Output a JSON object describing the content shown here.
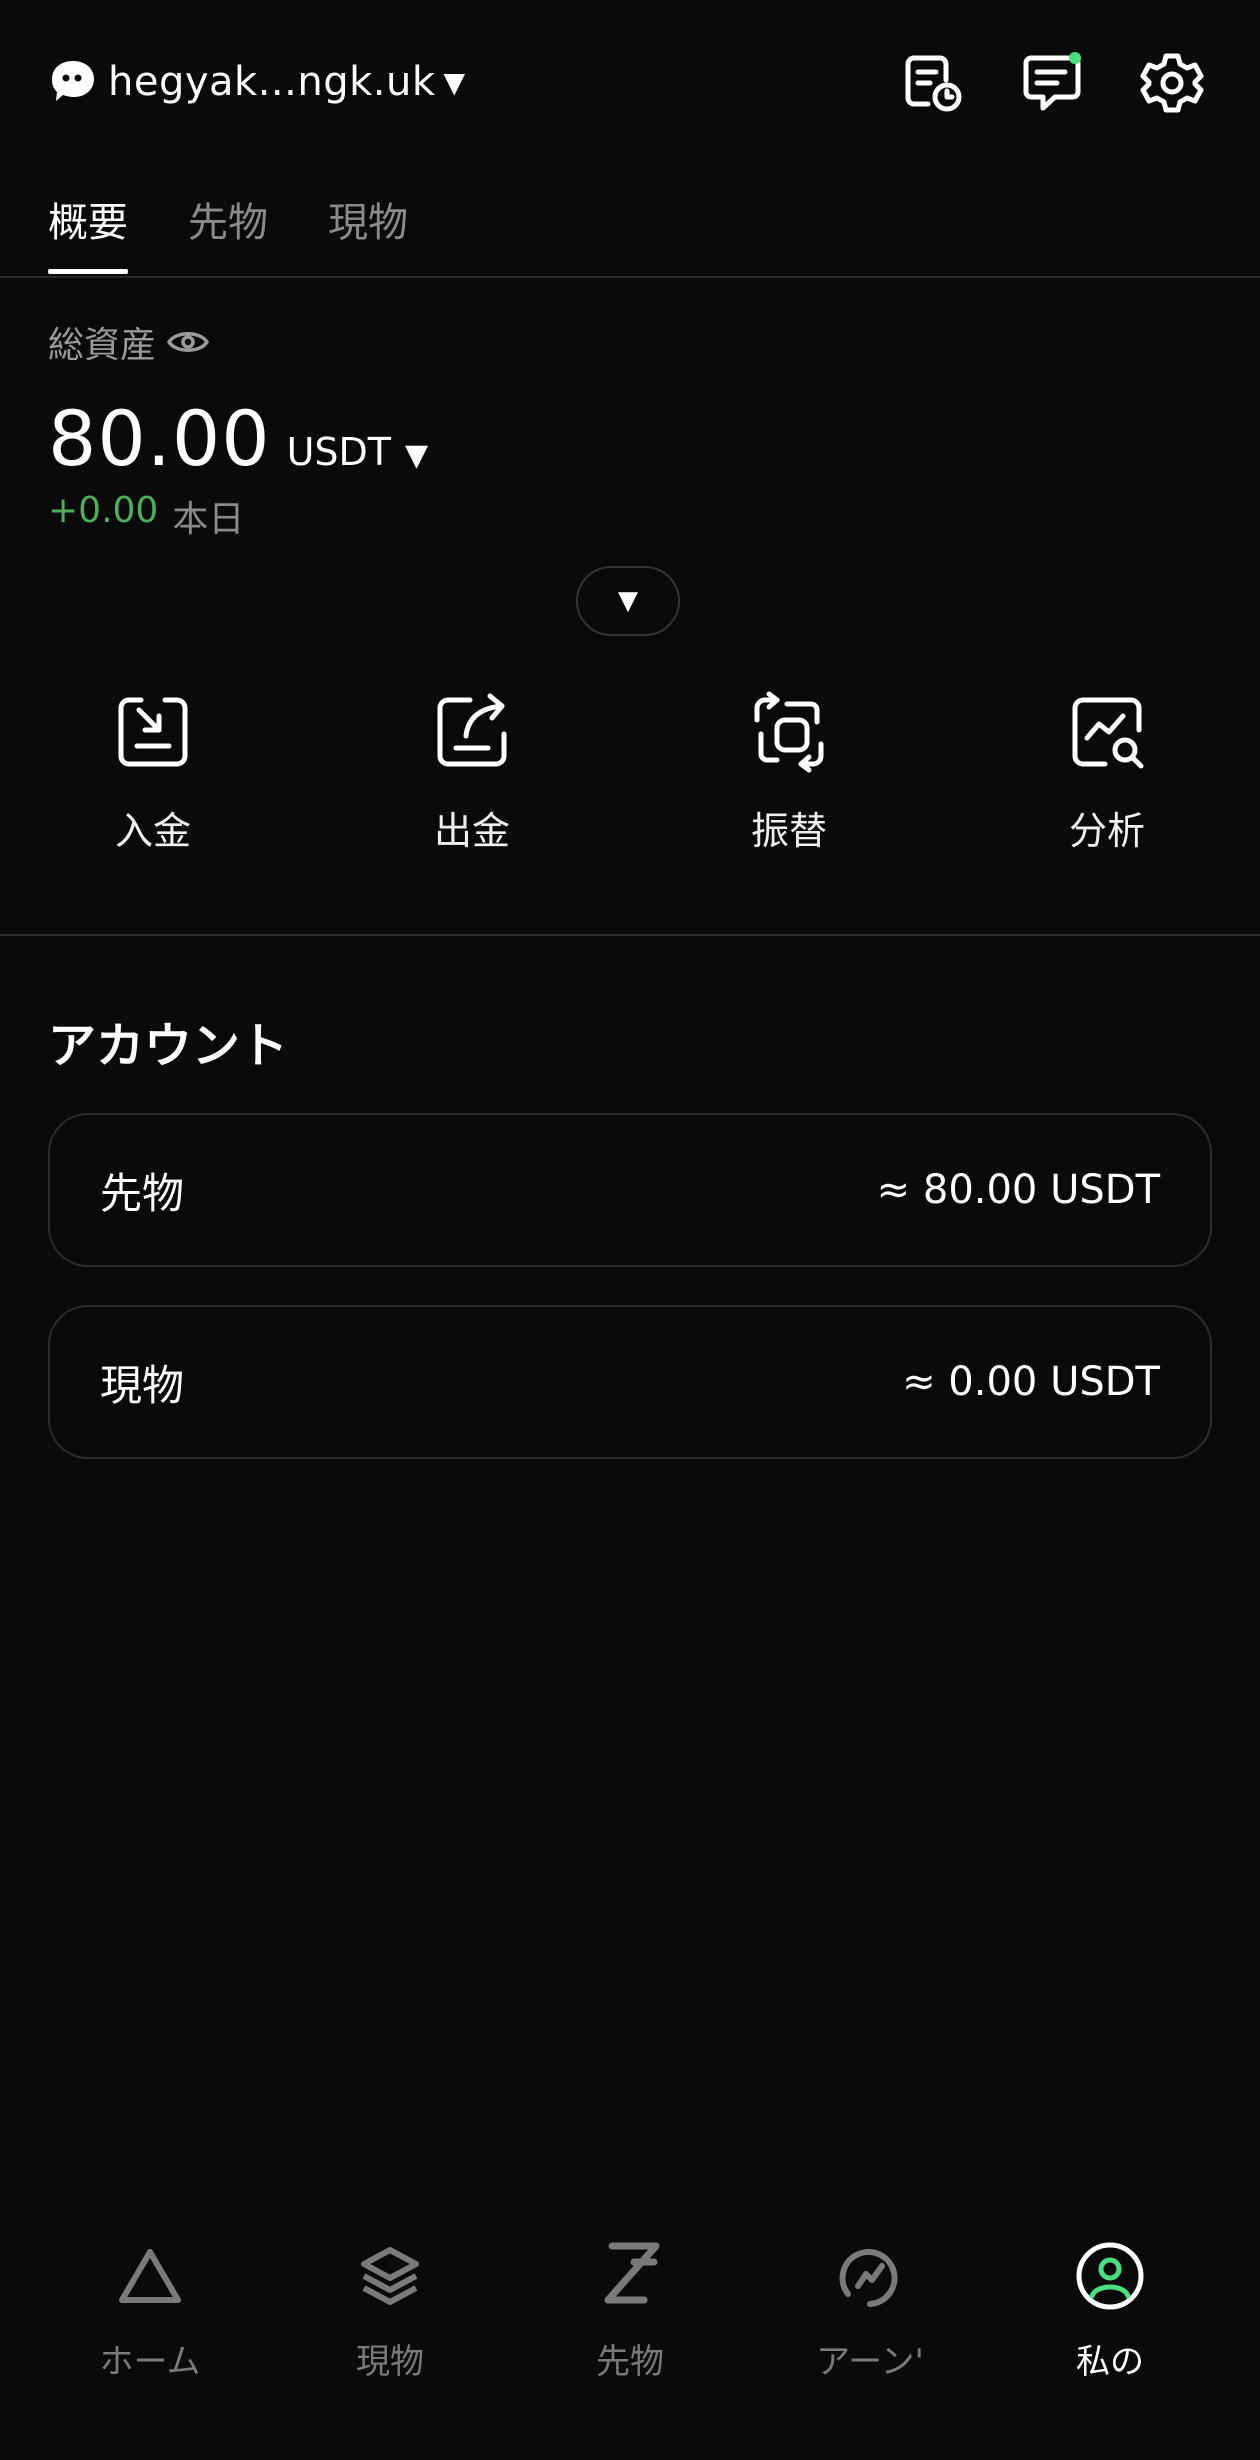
{
  "header": {
    "account_name": "hegyak...ngk.uk",
    "icons": [
      "order-history-icon",
      "messages-icon",
      "settings-icon"
    ],
    "notification_dot_color": "#4ade80"
  },
  "tabs": [
    {
      "label": "概要",
      "active": true
    },
    {
      "label": "先物",
      "active": false
    },
    {
      "label": "現物",
      "active": false
    }
  ],
  "balance": {
    "label": "総資産",
    "value": "80.00",
    "unit": "USDT",
    "pnl_value": "+0.00",
    "pnl_label": "本日",
    "pnl_color": "#4fae5b"
  },
  "actions": [
    {
      "label": "入金",
      "icon": "deposit-icon"
    },
    {
      "label": "出金",
      "icon": "withdraw-icon"
    },
    {
      "label": "振替",
      "icon": "transfer-icon"
    },
    {
      "label": "分析",
      "icon": "analysis-icon"
    }
  ],
  "accounts": {
    "title": "アカウント",
    "items": [
      {
        "name": "先物",
        "value": "≈ 80.00 USDT"
      },
      {
        "name": "現物",
        "value": "≈ 0.00 USDT"
      }
    ]
  },
  "bottom_nav": [
    {
      "label": "ホーム",
      "icon": "home-icon",
      "active": false
    },
    {
      "label": "現物",
      "icon": "spot-icon",
      "active": false
    },
    {
      "label": "先物",
      "icon": "futures-icon",
      "active": false
    },
    {
      "label": "アーン'",
      "icon": "earn-icon",
      "active": false
    },
    {
      "label": "私の",
      "icon": "profile-icon",
      "active": true
    }
  ],
  "accent_color": "#4ade80"
}
